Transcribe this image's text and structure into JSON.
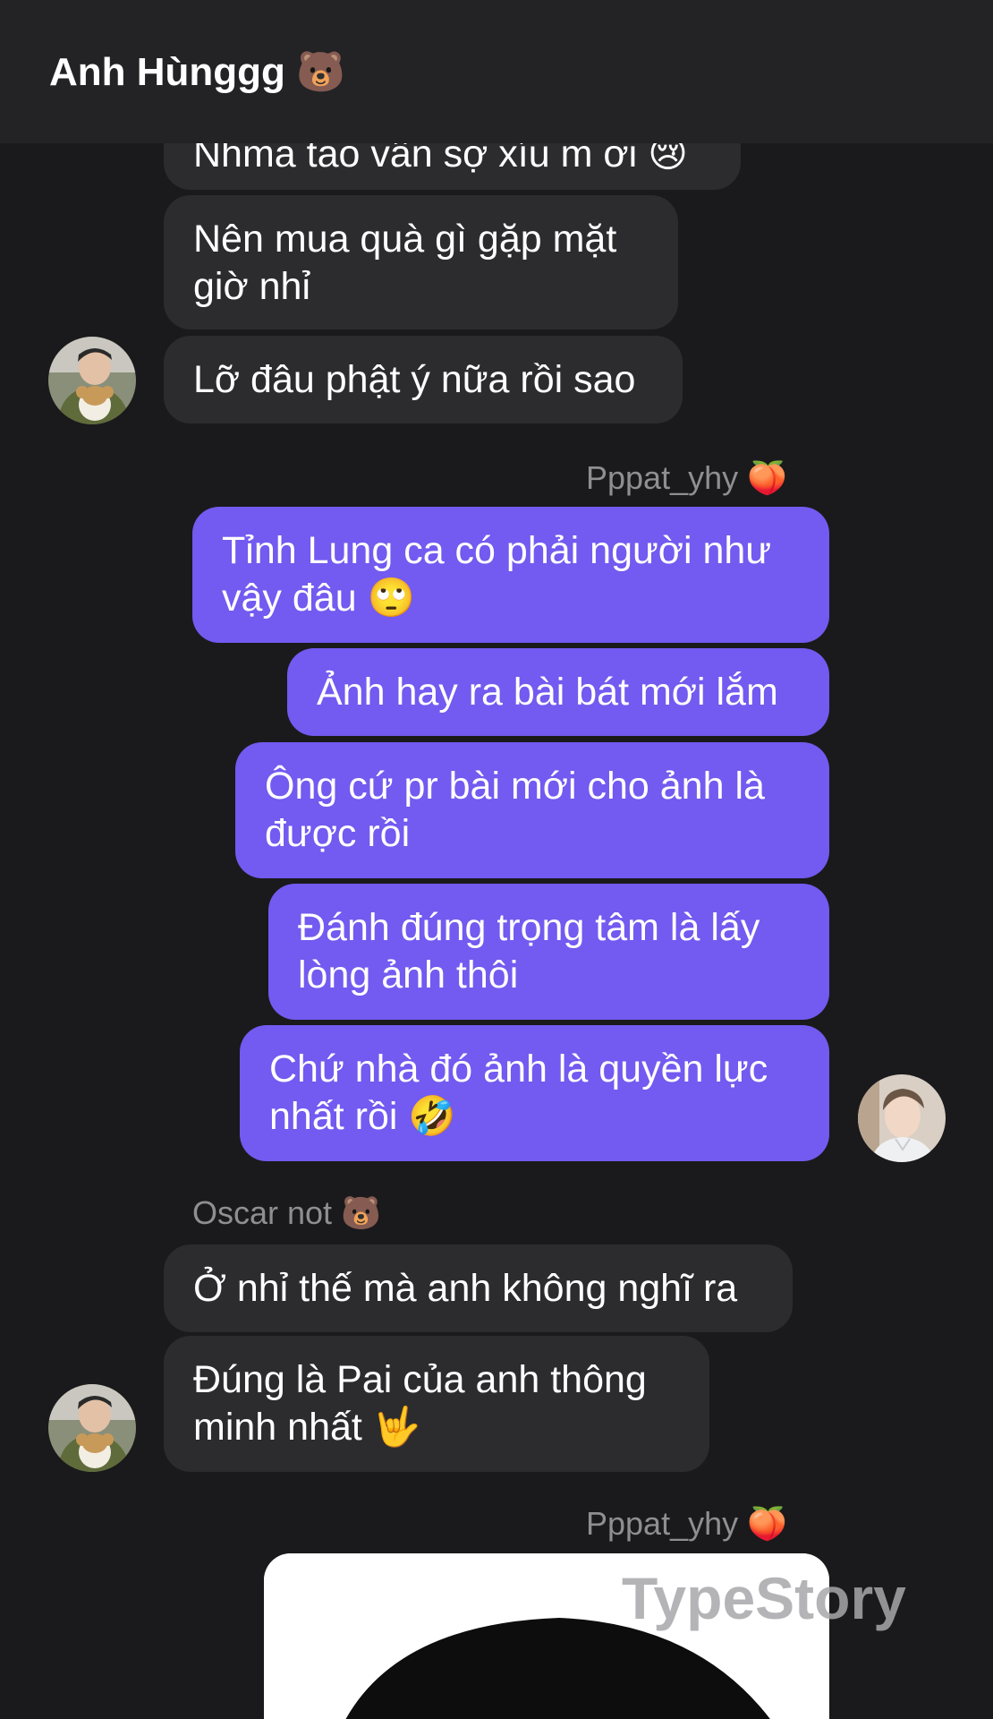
{
  "header": {
    "title": "Anh Hùnggg 🐻"
  },
  "messages": {
    "m1": "Nhma tao vẫn sợ xíu m ơi 😢",
    "m2": "Nên mua quà gì gặp mặt giờ nhỉ",
    "m3": "Lỡ đâu phật ý nữa rồi sao",
    "sender_out_1": "Pppat_yhy 🍑",
    "o1": "Tỉnh Lung ca có phải người như vậy đâu 🙄",
    "o2": "Ảnh hay ra bài bát mới lắm",
    "o3": "Ông cứ pr bài mới cho ảnh là được rồi",
    "o4": "Đánh đúng trọng tâm là lấy lòng ảnh thôi",
    "o5": "Chứ nhà đó ảnh là quyền lực nhất rồi 🤣",
    "sender_in_2": "Oscar not 🐻",
    "i1": "Ở nhỉ thế mà anh không nghĩ ra",
    "i2": "Đúng là Pai của anh thông minh nhất 🤟",
    "sender_out_2": "Pppat_yhy 🍑"
  },
  "watermark": "TypeStory",
  "colors": {
    "background": "#1a1a1c",
    "header": "#232325",
    "incoming_bubble": "#2c2c2f",
    "outgoing_bubble": "#735af0",
    "sender_name": "#8e8e93"
  }
}
